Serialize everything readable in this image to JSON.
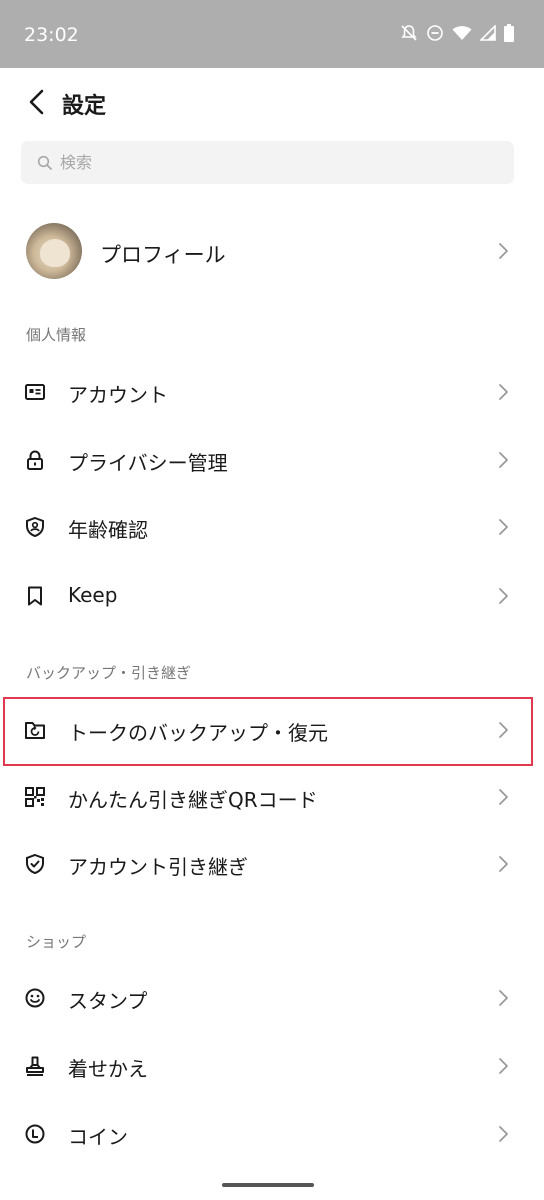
{
  "status": {
    "time": "23:02"
  },
  "header": {
    "title": "設定"
  },
  "search": {
    "placeholder": "検索"
  },
  "profile": {
    "label": "プロフィール"
  },
  "sections": {
    "personal": "個人情報",
    "backup": "バックアップ・引き継ぎ",
    "shop": "ショップ"
  },
  "items": {
    "account": "アカウント",
    "privacy": "プライバシー管理",
    "age": "年齢確認",
    "keep": "Keep",
    "talk_backup": "トークのバックアップ・復元",
    "qr_transfer": "かんたん引き継ぎQRコード",
    "account_transfer": "アカウント引き継ぎ",
    "stamp": "スタンプ",
    "theme": "着せかえ",
    "coin": "コイン"
  },
  "colors": {
    "highlight": "#e0394f",
    "statusbar": "#aeaeae"
  },
  "icons": [
    "notifications-off-icon",
    "do-not-disturb-icon",
    "wifi-icon",
    "signal-icon",
    "battery-icon",
    "back-arrow-icon",
    "search-icon",
    "id-card-icon",
    "lock-icon",
    "shield-person-icon",
    "bookmark-icon",
    "folder-restore-icon",
    "qr-code-icon",
    "shield-check-icon",
    "smile-icon",
    "stamp-icon",
    "clock-coin-icon",
    "chevron-right-icon"
  ]
}
